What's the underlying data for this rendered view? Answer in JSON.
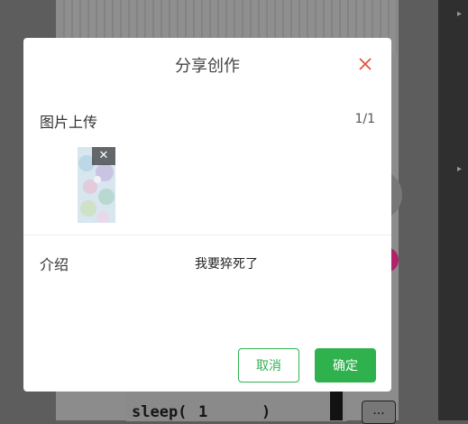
{
  "dialog": {
    "title": "分享创作",
    "image_section_label": "图片上传",
    "image_count": "1/1",
    "intro_label": "介绍",
    "intro_value": "我要猝死了",
    "cancel_label": "取消",
    "confirm_label": "确定",
    "remove_glyph": "✕"
  },
  "background": {
    "code_tokens": [
      "sleep(",
      "1",
      ")"
    ],
    "more_label": "..."
  },
  "colors": {
    "primary": "#2fb24e",
    "close_icon": "#e0533b",
    "overlay": "#5d5d5d"
  }
}
